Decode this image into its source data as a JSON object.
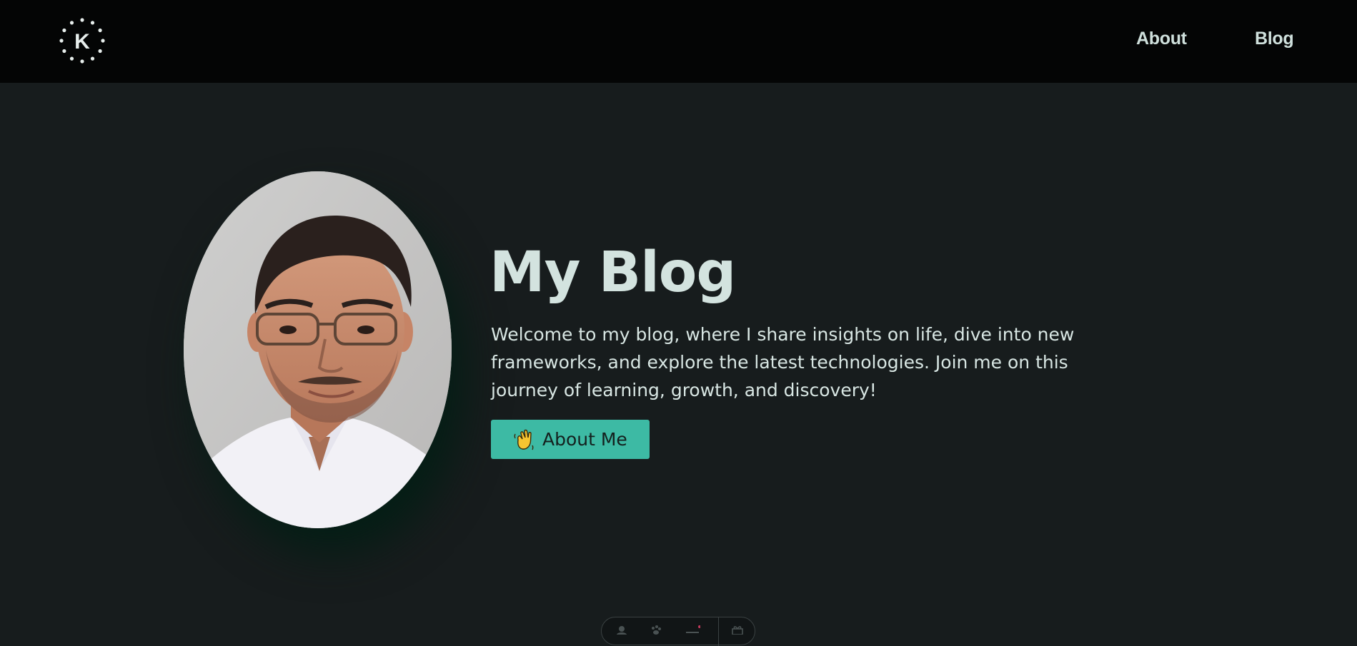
{
  "header": {
    "logo_icon": "k-dotted-circle-logo",
    "logo_letter": "K",
    "nav": [
      {
        "label": "About"
      },
      {
        "label": "Blog"
      }
    ]
  },
  "hero": {
    "title": "My Blog",
    "description": "Welcome to my blog, where I share insights on life, dive into new frameworks, and explore the latest technologies. Join me on this journey of learning, growth, and discovery!",
    "button": {
      "icon": "waving-hand-icon",
      "label": "About Me"
    },
    "portrait": "profile-photo"
  },
  "dock": {
    "items": [
      "user-icon",
      "paw-icon",
      "menu-icon",
      "gift-icon"
    ]
  },
  "colors": {
    "header_bg": "#040505",
    "page_bg": "#171c1d",
    "text": "#d3e3df",
    "accent": "#3dbaa4"
  }
}
